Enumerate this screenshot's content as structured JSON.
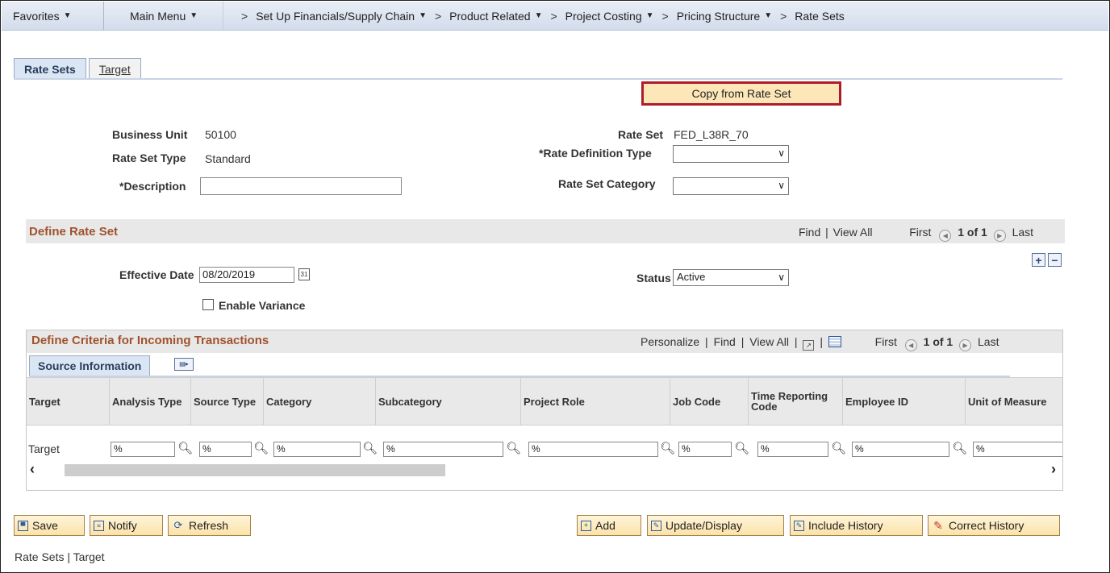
{
  "nav": {
    "favorites": "Favorites",
    "main_menu": "Main Menu",
    "crumbs": [
      "Set Up Financials/Supply Chain",
      "Product Related",
      "Project Costing",
      "Pricing Structure",
      "Rate Sets"
    ]
  },
  "tabs": [
    {
      "label": "Rate Sets",
      "active": true
    },
    {
      "label": "Target",
      "active": false
    }
  ],
  "copy_button": "Copy from Rate Set",
  "header": {
    "business_unit_label": "Business Unit",
    "business_unit_value": "50100",
    "rate_set_type_label": "Rate Set Type",
    "rate_set_type_value": "Standard",
    "description_label": "*Description",
    "description_value": "",
    "rate_set_label": "Rate Set",
    "rate_set_value": "FED_L38R_70",
    "rate_def_type_label": "*Rate Definition Type",
    "rate_def_type_value": "",
    "rate_set_category_label": "Rate Set Category",
    "rate_set_category_value": ""
  },
  "define_rate_set": {
    "title": "Define Rate Set",
    "find": "Find",
    "view_all": "View All",
    "first": "First",
    "count": "1 of 1",
    "last": "Last",
    "effective_date_label": "Effective Date",
    "effective_date_value": "08/20/2019",
    "status_label": "Status",
    "status_value": "Active",
    "enable_variance_label": "Enable Variance"
  },
  "criteria": {
    "title": "Define Criteria for Incoming Transactions",
    "personalize": "Personalize",
    "find": "Find",
    "view_all": "View All",
    "first": "First",
    "count": "1 of 1",
    "last": "Last",
    "subtab": "Source Information",
    "columns": [
      "Target",
      "Analysis Type",
      "Source Type",
      "Category",
      "Subcategory",
      "Project Role",
      "Job Code",
      "Time Reporting Code",
      "Employee ID",
      "Unit of Measure"
    ],
    "row": {
      "target": "Target",
      "values": [
        "%",
        "%",
        "%",
        "%",
        "%",
        "%",
        "%",
        "%",
        "%"
      ]
    }
  },
  "footer_buttons": {
    "save": "Save",
    "notify": "Notify",
    "refresh": "Refresh",
    "add": "Add",
    "update_display": "Update/Display",
    "include_history": "Include History",
    "correct_history": "Correct History"
  },
  "footer_links": {
    "rate_sets": "Rate Sets",
    "target": "Target"
  }
}
